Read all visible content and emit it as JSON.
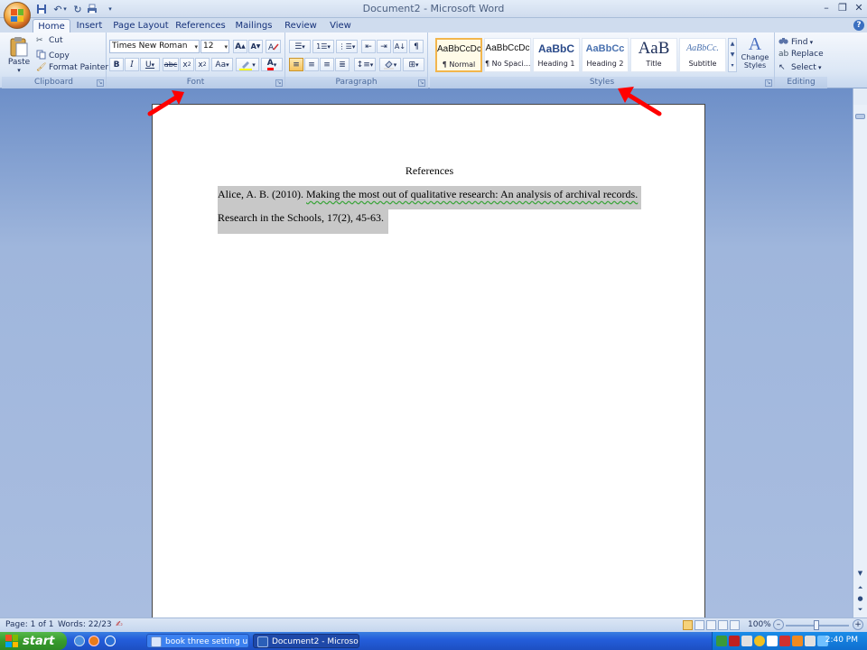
{
  "window": {
    "title": "Document2 - Microsoft Word"
  },
  "tabs": [
    "Home",
    "Insert",
    "Page Layout",
    "References",
    "Mailings",
    "Review",
    "View"
  ],
  "clipboard": {
    "paste": "Paste",
    "cut": "Cut",
    "copy": "Copy",
    "format_painter": "Format Painter",
    "label": "Clipboard"
  },
  "font": {
    "name": "Times New Roman",
    "size": "12",
    "label": "Font"
  },
  "paragraph": {
    "label": "Paragraph"
  },
  "styles": {
    "items": [
      {
        "sample": "AaBbCcDc",
        "name": "¶ Normal"
      },
      {
        "sample": "AaBbCcDc",
        "name": "¶ No Spaci..."
      },
      {
        "sample": "AaBbC",
        "name": "Heading 1"
      },
      {
        "sample": "AaBbCc",
        "name": "Heading 2"
      },
      {
        "sample": "AaB",
        "name": "Title"
      },
      {
        "sample": "AaBbCc.",
        "name": "Subtitle"
      }
    ],
    "change_styles": "Change Styles",
    "label": "Styles"
  },
  "editing": {
    "find": "Find",
    "replace": "Replace",
    "select": "Select",
    "label": "Editing"
  },
  "document": {
    "heading": "References",
    "line1_plain": "Alice, A. B. (2010). ",
    "line1_underlined": "Making the most out of qualitative research:  An analysis of archival records.",
    "line2": "Research in the Schools, 17(2), 45-63."
  },
  "status": {
    "page": "Page: 1 of 1",
    "words": "Words: 22/23",
    "zoom": "100%"
  },
  "taskbar": {
    "start": "start",
    "apps": [
      "book three setting up...",
      "Document2 - Microsof..."
    ],
    "clock": "2:40 PM"
  },
  "colors": {
    "ribbon_blue": "#dce7f5",
    "arrow_red": "#ff0000",
    "highlight_gray": "#c8c8c8",
    "taskbar_blue": "#245edb"
  }
}
